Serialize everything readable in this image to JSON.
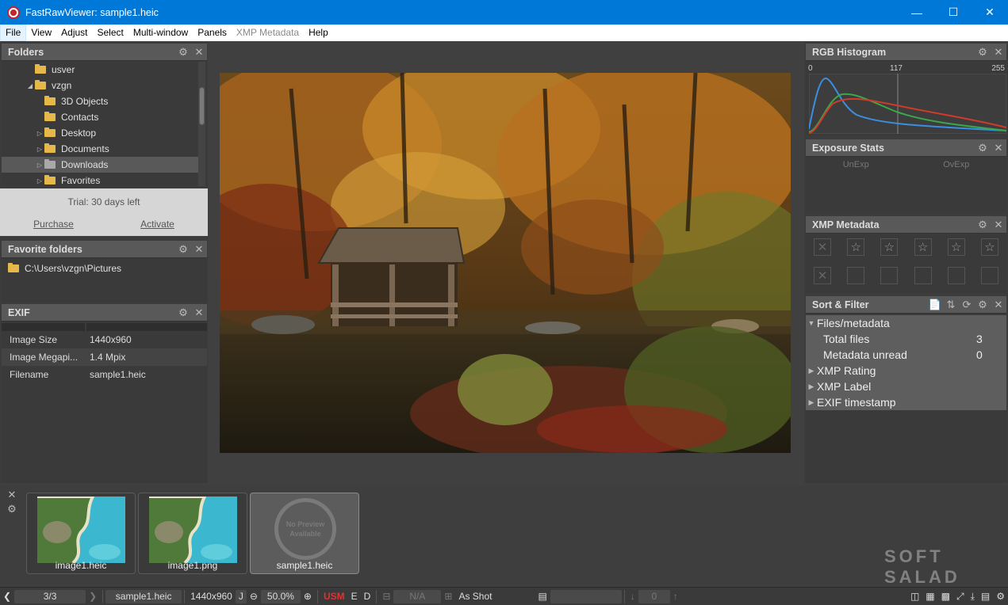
{
  "window": {
    "title": "FastRawViewer: sample1.heic",
    "controls": [
      "minimize",
      "maximize",
      "close"
    ]
  },
  "menu": [
    {
      "label": "File",
      "active": true
    },
    {
      "label": "View"
    },
    {
      "label": "Adjust"
    },
    {
      "label": "Select"
    },
    {
      "label": "Multi-window"
    },
    {
      "label": "Panels"
    },
    {
      "label": "XMP Metadata",
      "disabled": true
    },
    {
      "label": "Help"
    }
  ],
  "folders": {
    "title": "Folders",
    "items": [
      {
        "label": "usver",
        "indent": 1,
        "arrow": ""
      },
      {
        "label": "vzgn",
        "indent": 1,
        "arrow": "◢"
      },
      {
        "label": "3D Objects",
        "indent": 2,
        "arrow": ""
      },
      {
        "label": "Contacts",
        "indent": 2,
        "arrow": ""
      },
      {
        "label": "Desktop",
        "indent": 2,
        "arrow": "▷"
      },
      {
        "label": "Documents",
        "indent": 2,
        "arrow": "▷"
      },
      {
        "label": "Downloads",
        "indent": 2,
        "arrow": "▷",
        "selected": true
      },
      {
        "label": "Favorites",
        "indent": 2,
        "arrow": "▷"
      }
    ]
  },
  "trial": {
    "text": "Trial: 30 days left",
    "purchase": "Purchase",
    "activate": "Activate"
  },
  "favorites": {
    "title": "Favorite folders",
    "path": "C:\\Users\\vzgn\\Pictures"
  },
  "exif": {
    "title": "EXIF",
    "rows": [
      {
        "key": "Image Size",
        "value": "1440x960"
      },
      {
        "key": "Image Megapi...",
        "value": "1.4 Mpix"
      },
      {
        "key": "Filename",
        "value": "sample1.heic"
      }
    ]
  },
  "histogram": {
    "title": "RGB Histogram",
    "ticks": [
      "0",
      "117",
      "255"
    ]
  },
  "exposure": {
    "title": "Exposure Stats",
    "cols": [
      "UnExp",
      "OvExp"
    ]
  },
  "xmp": {
    "title": "XMP Metadata"
  },
  "sort": {
    "title": "Sort & Filter",
    "group": "Files/metadata",
    "rows": [
      {
        "label": "Total files",
        "value": "3"
      },
      {
        "label": "Metadata unread",
        "value": "0"
      }
    ],
    "collapsed": [
      "XMP Rating",
      "XMP Label",
      "EXIF timestamp"
    ]
  },
  "filmstrip": [
    {
      "caption": "image1.heic",
      "kind": "island"
    },
    {
      "caption": "image1.png",
      "kind": "island"
    },
    {
      "caption": "sample1.heic",
      "kind": "none",
      "selected": true,
      "placeholder": "No Preview Available"
    }
  ],
  "status": {
    "page": "3/3",
    "filename": "sample1.heic",
    "size": "1440x960",
    "j": "J",
    "zoom": "50.0%",
    "usm": "USM",
    "e": "E",
    "d": "D",
    "na": "N/A",
    "as_shot": "As Shot",
    "zero": "0"
  },
  "watermark": "SOFT SALAD"
}
